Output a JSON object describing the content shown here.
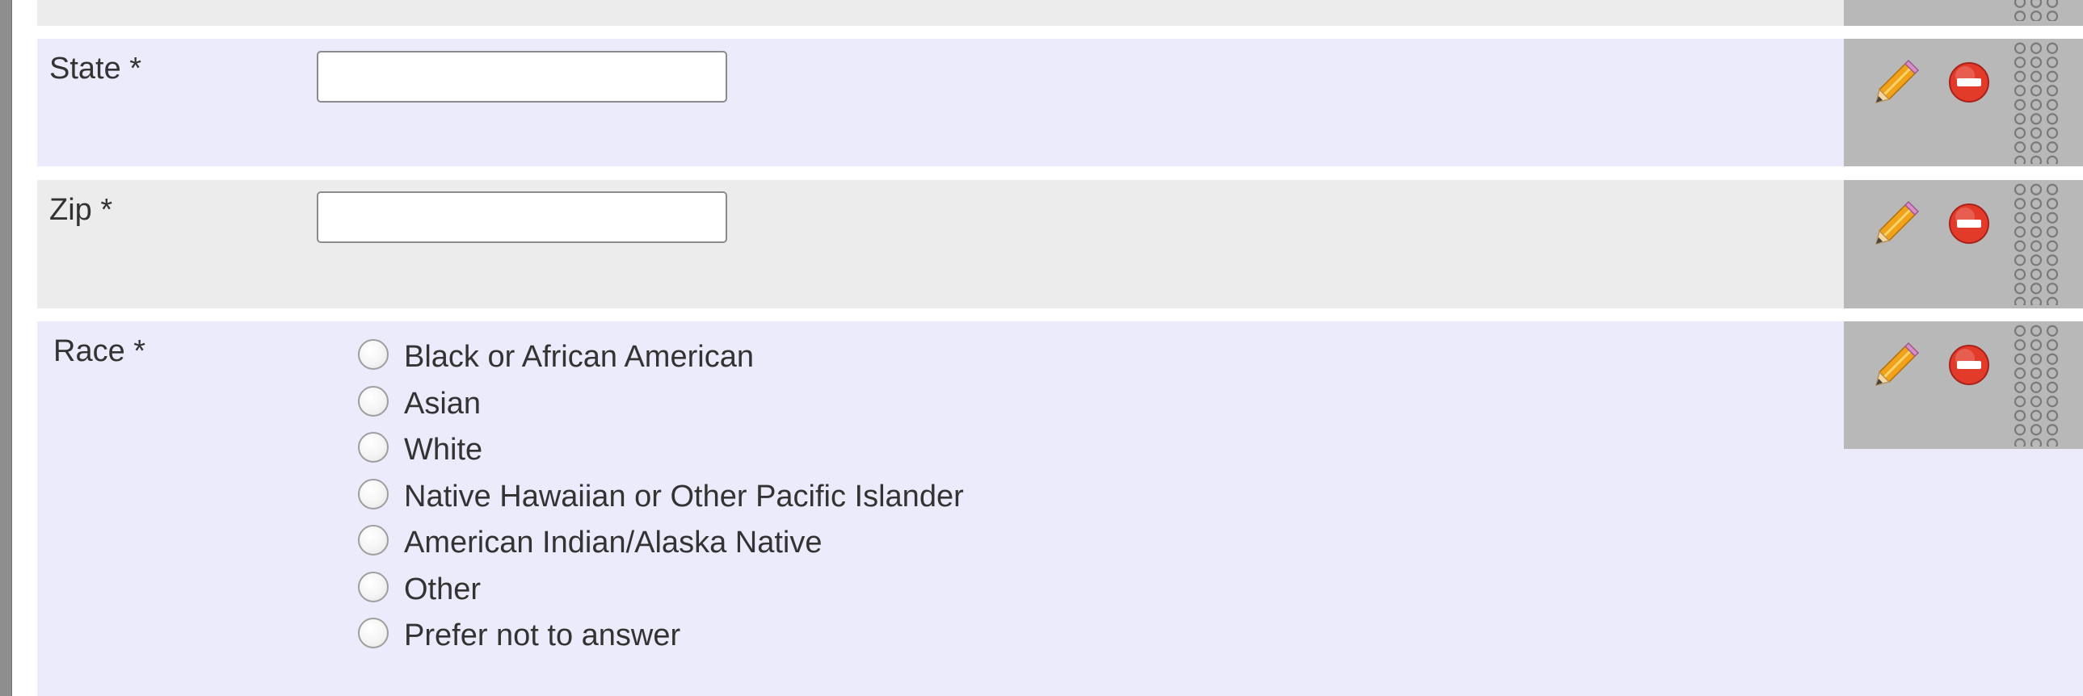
{
  "form": {
    "fields": [
      {
        "label": "State *",
        "input_value": ""
      },
      {
        "label": "Zip *",
        "input_value": ""
      },
      {
        "label": "Race *",
        "options": [
          "Black or African American",
          "Asian",
          "White",
          "Native Hawaiian or Other Pacific Islander",
          "American Indian/Alaska Native",
          "Other",
          "Prefer not to answer"
        ]
      }
    ]
  },
  "controls": {
    "edit_icon": "pencil-icon",
    "delete_icon": "no-entry-icon",
    "drag_icon": "drag-dots-icon"
  },
  "colors": {
    "row_lavender": "#ecebfb",
    "row_gray": "#ececec",
    "controls_bg": "#b8b8b8",
    "delete_red": "#e23b2a",
    "pencil_orange": "#f0a21a"
  }
}
